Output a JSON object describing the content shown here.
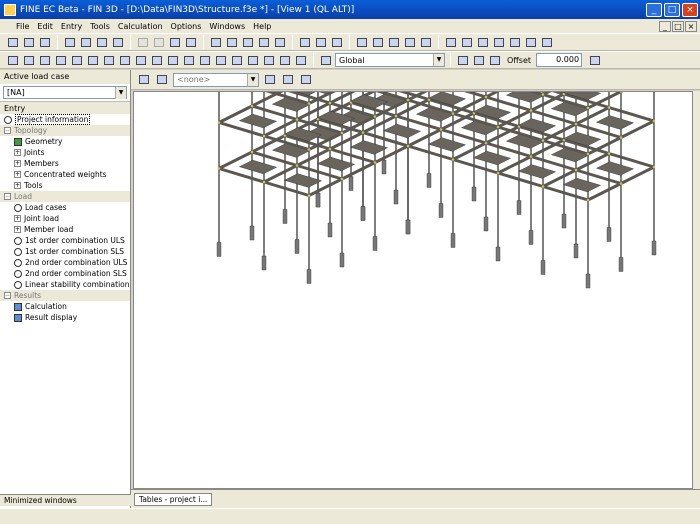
{
  "window": {
    "title": "FINE EC Beta - FIN 3D - [D:\\Data\\FIN3D\\Structure.f3e *] - [View 1 (QL ALT)]",
    "minimize_label": "_",
    "maximize_label": "□",
    "close_label": "×"
  },
  "menu": {
    "items": [
      "File",
      "Edit",
      "Entry",
      "Tools",
      "Calculation",
      "Options",
      "Windows",
      "Help"
    ]
  },
  "toolbar2": {
    "combo_value": "Global",
    "offset_label": "Offset",
    "offset_value": "0.000"
  },
  "left_panel": {
    "active_case_header": "Active load case",
    "active_case_value": "[NA]",
    "entry_header": "Entry",
    "tree": [
      {
        "label": "Project information",
        "kind": "item",
        "icon": "info-icon",
        "selected": true
      },
      {
        "label": "Topology",
        "kind": "section"
      },
      {
        "label": "Geometry",
        "kind": "item",
        "icon": "geometry-icon"
      },
      {
        "label": "Joints",
        "kind": "expandable"
      },
      {
        "label": "Members",
        "kind": "expandable"
      },
      {
        "label": "Concentrated weights",
        "kind": "expandable"
      },
      {
        "label": "Tools",
        "kind": "expandable"
      },
      {
        "label": "Load",
        "kind": "section"
      },
      {
        "label": "Load cases",
        "kind": "radio"
      },
      {
        "label": "Joint load",
        "kind": "expandable"
      },
      {
        "label": "Member load",
        "kind": "expandable"
      },
      {
        "label": "1st order combination ULS",
        "kind": "radio"
      },
      {
        "label": "1st order combination SLS",
        "kind": "radio"
      },
      {
        "label": "2nd order combination ULS",
        "kind": "radio"
      },
      {
        "label": "2nd order combination SLS",
        "kind": "radio"
      },
      {
        "label": "Linear stability combination",
        "kind": "radio"
      },
      {
        "label": "Results",
        "kind": "section"
      },
      {
        "label": "Calculation",
        "kind": "item",
        "icon": "calculation-icon"
      },
      {
        "label": "Result display",
        "kind": "item",
        "icon": "result-icon"
      }
    ],
    "minimized_label": "Minimized windows"
  },
  "view_toolbar": {
    "combo_value": "<none>"
  },
  "bottom_tab": {
    "label": "Tables - project i..."
  },
  "colors": {
    "title_bar": "#0a4cc4",
    "member_fill": "#5b5750",
    "joint_color": "#c8c84a"
  }
}
